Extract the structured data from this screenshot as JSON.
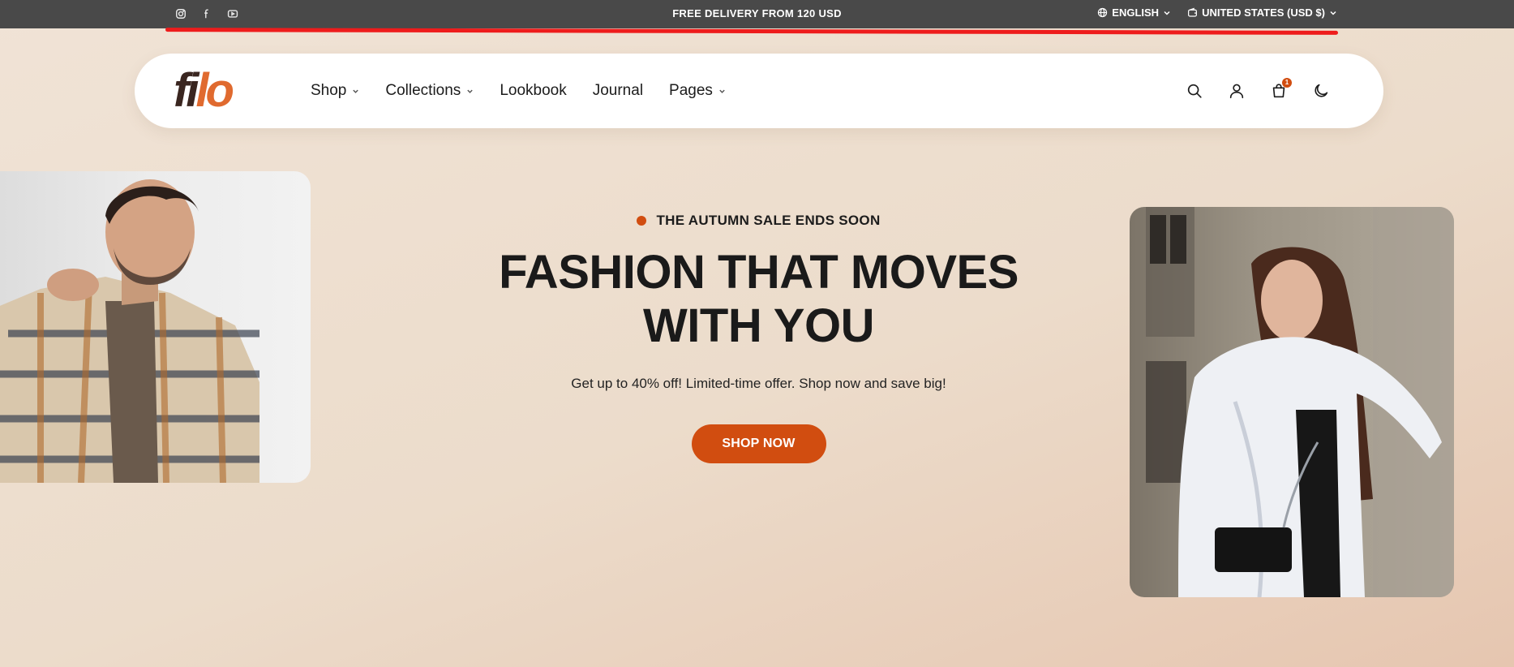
{
  "topbar": {
    "social": [
      {
        "icon": "instagram-icon"
      },
      {
        "icon": "facebook-icon"
      },
      {
        "icon": "youtube-icon"
      }
    ],
    "promo": "FREE DELIVERY FROM 120 USD",
    "language": "ENGLISH",
    "currency": "UNITED STATES (USD $)"
  },
  "header": {
    "logo_part1": "fi",
    "logo_part2": "lo",
    "nav": [
      {
        "label": "Shop",
        "dropdown": true
      },
      {
        "label": "Collections",
        "dropdown": true
      },
      {
        "label": "Lookbook",
        "dropdown": false
      },
      {
        "label": "Journal",
        "dropdown": false
      },
      {
        "label": "Pages",
        "dropdown": true
      }
    ],
    "cart_count": "1"
  },
  "hero": {
    "eyebrow": "THE AUTUMN SALE ENDS SOON",
    "headline_line1": "FASHION THAT MOVES",
    "headline_line2": "WITH YOU",
    "subtext": "Get up to 40% off! Limited-time offer. Shop now and save big!",
    "cta": "SHOP NOW"
  },
  "colors": {
    "accent": "#d14d10",
    "topbar_bg": "#494949",
    "logo_dark": "#3a2620",
    "logo_orange": "#e06a2f",
    "page_bg": "#efe1d3"
  }
}
